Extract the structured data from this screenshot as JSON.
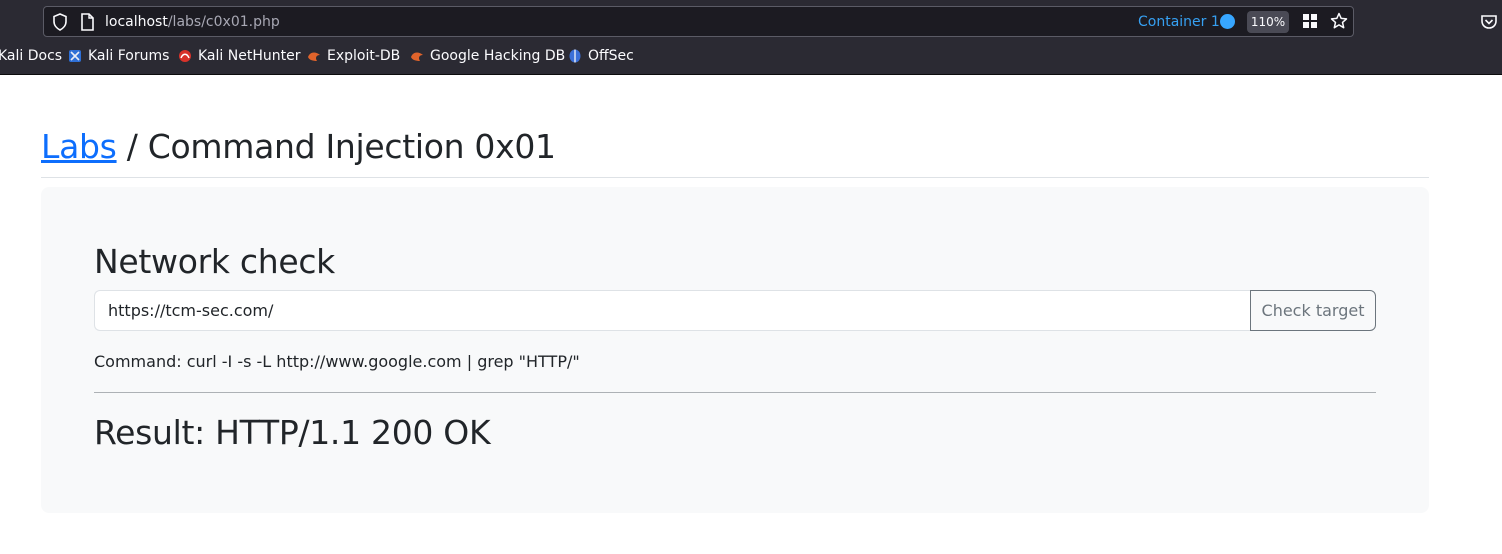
{
  "browser": {
    "url_host": "localhost",
    "url_path": "/labs/c0x01.php",
    "container_label": "Container 1",
    "zoom_level": "110%",
    "accent_color": "#36a0f2",
    "bookmarks": [
      {
        "label": "Kali Docs",
        "icon": "kali-docs-icon"
      },
      {
        "label": "Kali Forums",
        "icon": "kali-forums-icon"
      },
      {
        "label": "Kali NetHunter",
        "icon": "kali-nethunter-icon"
      },
      {
        "label": "Exploit-DB",
        "icon": "exploit-db-icon"
      },
      {
        "label": "Google Hacking DB",
        "icon": "google-hacking-db-icon"
      },
      {
        "label": "OffSec",
        "icon": "offsec-icon"
      }
    ]
  },
  "page": {
    "breadcrumb_link": "Labs",
    "breadcrumb_separator": " / ",
    "breadcrumb_current": "Command Injection 0x01",
    "link_color": "#0d6efd",
    "card": {
      "heading": "Network check",
      "input_value": "https://tcm-sec.com/",
      "button_label": "Check target",
      "command_text": "Command: curl -I -s -L http://www.google.com | grep \"HTTP/\"",
      "result_text": "Result: HTTP/1.1 200 OK"
    }
  }
}
